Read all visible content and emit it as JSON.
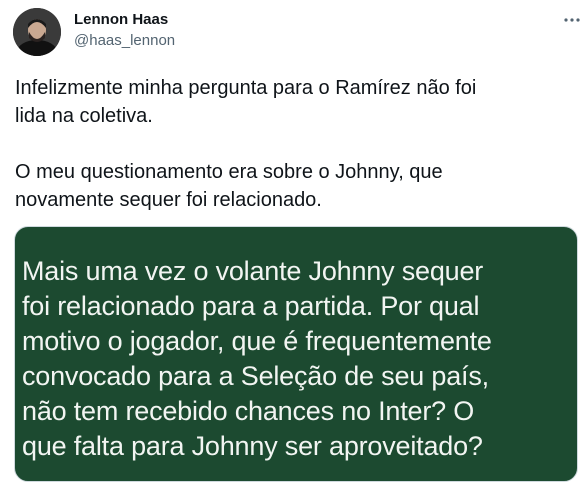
{
  "author": {
    "display_name": "Lennon Haas",
    "handle": "@haas_lennon"
  },
  "tweet": {
    "text": "Infelizmente minha pergunta para o Ramírez não foi\nlida na coletiva.\n\nO meu questionamento era sobre o Johnny, que\nnovamente sequer foi relacionado."
  },
  "media": {
    "text": "Mais uma vez o volante Johnny sequer\nfoi relacionado para a partida. Por qual\nmotivo o jogador, que é frequentemente\nconvocado para a Seleção de seu país,\nnão tem recebido chances no Inter? O\nque falta para Johnny ser aproveitado?",
    "background": "#1c4a30"
  },
  "icons": {
    "more": "more-dots-icon"
  }
}
